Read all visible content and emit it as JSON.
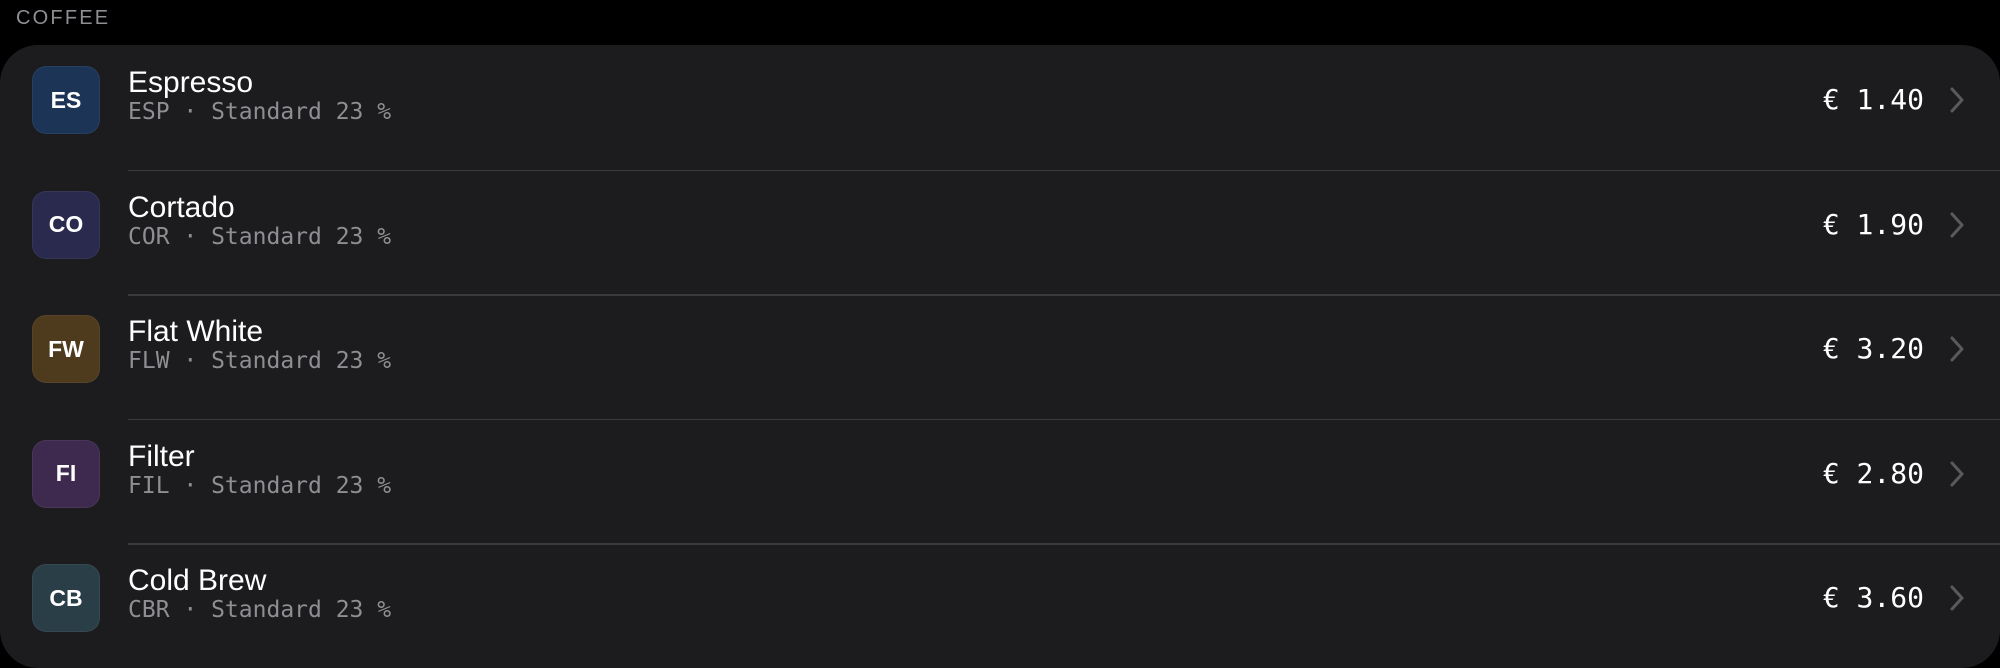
{
  "section": {
    "title": "COFFEE"
  },
  "items": [
    {
      "initials": "ES",
      "name": "Espresso",
      "code": "ESP",
      "tax": "Standard 23 %",
      "meta": "ESP · Standard 23 %",
      "price": "€ 1.40",
      "color": "#1c3456"
    },
    {
      "initials": "CO",
      "name": "Cortado",
      "code": "COR",
      "tax": "Standard 23 %",
      "meta": "COR · Standard 23 %",
      "price": "€ 1.90",
      "color": "#2a2a4e"
    },
    {
      "initials": "FW",
      "name": "Flat White",
      "code": "FLW",
      "tax": "Standard 23 %",
      "meta": "FLW · Standard 23 %",
      "price": "€ 3.20",
      "color": "#4e3a1c"
    },
    {
      "initials": "FI",
      "name": "Filter",
      "code": "FIL",
      "tax": "Standard 23 %",
      "meta": "FIL · Standard 23 %",
      "price": "€ 2.80",
      "color": "#3e2a4e"
    },
    {
      "initials": "CB",
      "name": "Cold Brew",
      "code": "CBR",
      "tax": "Standard 23 %",
      "meta": "CBR · Standard 23 %",
      "price": "€ 3.60",
      "color": "#2a3e48"
    }
  ],
  "icons": {
    "row_disclosure": "chevron-right-icon"
  },
  "colors": {
    "background": "#000000",
    "card": "#1c1c1e",
    "separator": "#3a3a3c",
    "secondary_text": "#8e8e93",
    "chevron": "#5a5a5e"
  }
}
